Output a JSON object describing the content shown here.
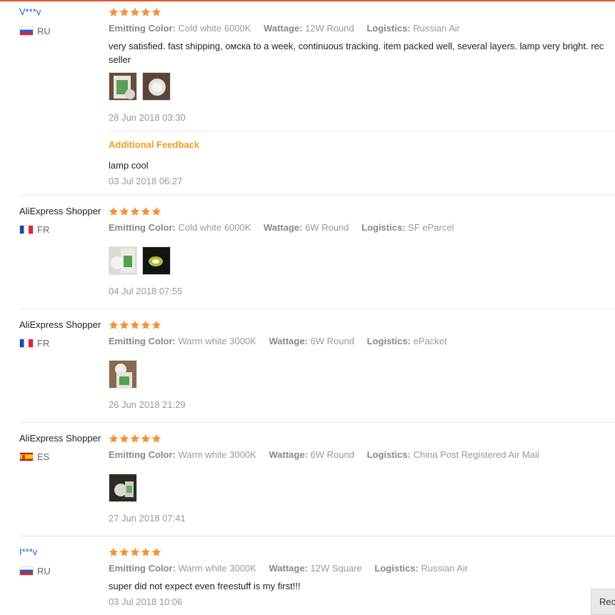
{
  "labels": {
    "emitting_color": "Emitting Color:",
    "wattage": "Wattage:",
    "logistics": "Logistics:",
    "additional_feedback": "Additional Feedback"
  },
  "rating_stars": 5,
  "star_color": "#f4923b",
  "reviews": [
    {
      "user": "V***v",
      "country": "RU",
      "emitting_color": "Cold white 6000K",
      "wattage": "12W Round",
      "logistics": "Russian Air",
      "comment": "very satisfied. fast shipping, омска to a week, continuous tracking. item packed well, several layers. lamp very bright. rec",
      "comment_line2": "seller",
      "date": "28 Jun 2018 03:30",
      "additional_comment": "lamp cool",
      "additional_date": "03 Jul 2018 06:27"
    },
    {
      "user": "AliExpress Shopper",
      "country": "FR",
      "emitting_color": "Cold white 6000K",
      "wattage": "6W Round",
      "logistics": "SF eParcel",
      "date": "04 Jul 2018 07:55"
    },
    {
      "user": "AliExpress Shopper",
      "country": "FR",
      "emitting_color": "Warm white 3000K",
      "wattage": "6W Round",
      "logistics": "ePacket",
      "date": "26 Jun 2018 21:29"
    },
    {
      "user": "AliExpress Shopper",
      "country": "ES",
      "emitting_color": "Warm white 3000K",
      "wattage": "6W Round",
      "logistics": "China Post Registered Air Mail",
      "date": "27 Jun 2018 07:41"
    },
    {
      "user": "I***v",
      "country": "RU",
      "emitting_color": "Warm white 3000K",
      "wattage": "12W Square",
      "logistics": "Russian Air",
      "comment": "super did not expect even freestuff is my first!!!",
      "date": "03 Jul 2018 10:06"
    }
  ],
  "corner_button": {
    "label": "Rec"
  }
}
